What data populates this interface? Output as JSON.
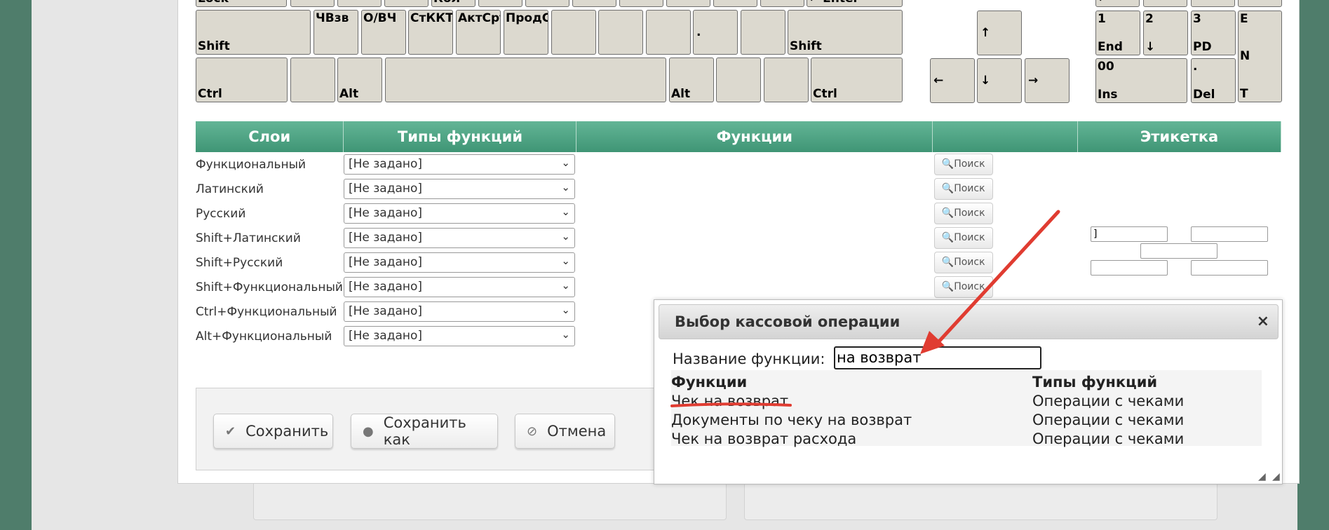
{
  "keyboard": {
    "row0": [
      "Lock",
      "",
      "",
      "",
      "Кол-",
      "",
      "",
      "",
      "",
      "",
      "",
      "← Enter"
    ],
    "row0_numpad": [
      "←",
      "",
      "",
      ""
    ],
    "shift_left": "Shift",
    "shift_right": "Shift",
    "func_keys": [
      "ЧВзв",
      "О/ВЧ",
      "СтККТ",
      "АктСрт",
      "ПродСр"
    ],
    "dot_key": ".",
    "ctrl_left": "Ctrl",
    "alt_left": "Alt",
    "alt_right": "Alt",
    "ctrl_right": "Ctrl",
    "arrows": {
      "up": "↑",
      "left": "←",
      "down": "↓",
      "right": "→"
    },
    "numpad": {
      "k1": {
        "top": "1",
        "bottom": "End"
      },
      "k2": {
        "top": "2",
        "bottom": "↓"
      },
      "k3": {
        "top": "3",
        "bottom": "PD"
      },
      "k00": {
        "top": "00",
        "bottom": "Ins"
      },
      "kdot": {
        "top": ".",
        "bottom": "Del"
      },
      "enter": [
        "E",
        "N",
        "T"
      ]
    }
  },
  "table": {
    "headers": [
      "Слои",
      "Типы функций",
      "Функции",
      "",
      "Этикетка"
    ],
    "select_value": "[Не задано]",
    "search_label": "Поиск",
    "rows": [
      {
        "layer": "Функциональный"
      },
      {
        "layer": "Латинский"
      },
      {
        "layer": "Русский"
      },
      {
        "layer": "Shift+Латинский"
      },
      {
        "layer": "Shift+Русский"
      },
      {
        "layer": "Shift+Функциональный"
      },
      {
        "layer": "Ctrl+Функциональный"
      },
      {
        "layer": "Alt+Функциональный"
      }
    ],
    "label_first_value": "]"
  },
  "buttons": {
    "save": "Сохранить",
    "save_as": "Сохранить как",
    "cancel": "Отмена"
  },
  "dialog": {
    "title": "Выбор кассовой операции",
    "close": "×",
    "field_label": "Название функции:",
    "field_value": "на возврат",
    "col_functions": "Функции",
    "col_types": "Типы функций",
    "results": [
      {
        "name": "Чек на возврат",
        "type": "Операции с чеками"
      },
      {
        "name": "Документы по чеку на возврат",
        "type": "Операции с чеками"
      },
      {
        "name": "Чек на возврат расхода",
        "type": "Операции с чеками"
      }
    ]
  },
  "colors": {
    "accent_green": "#46a07d",
    "annotation_red": "#e03c31"
  }
}
